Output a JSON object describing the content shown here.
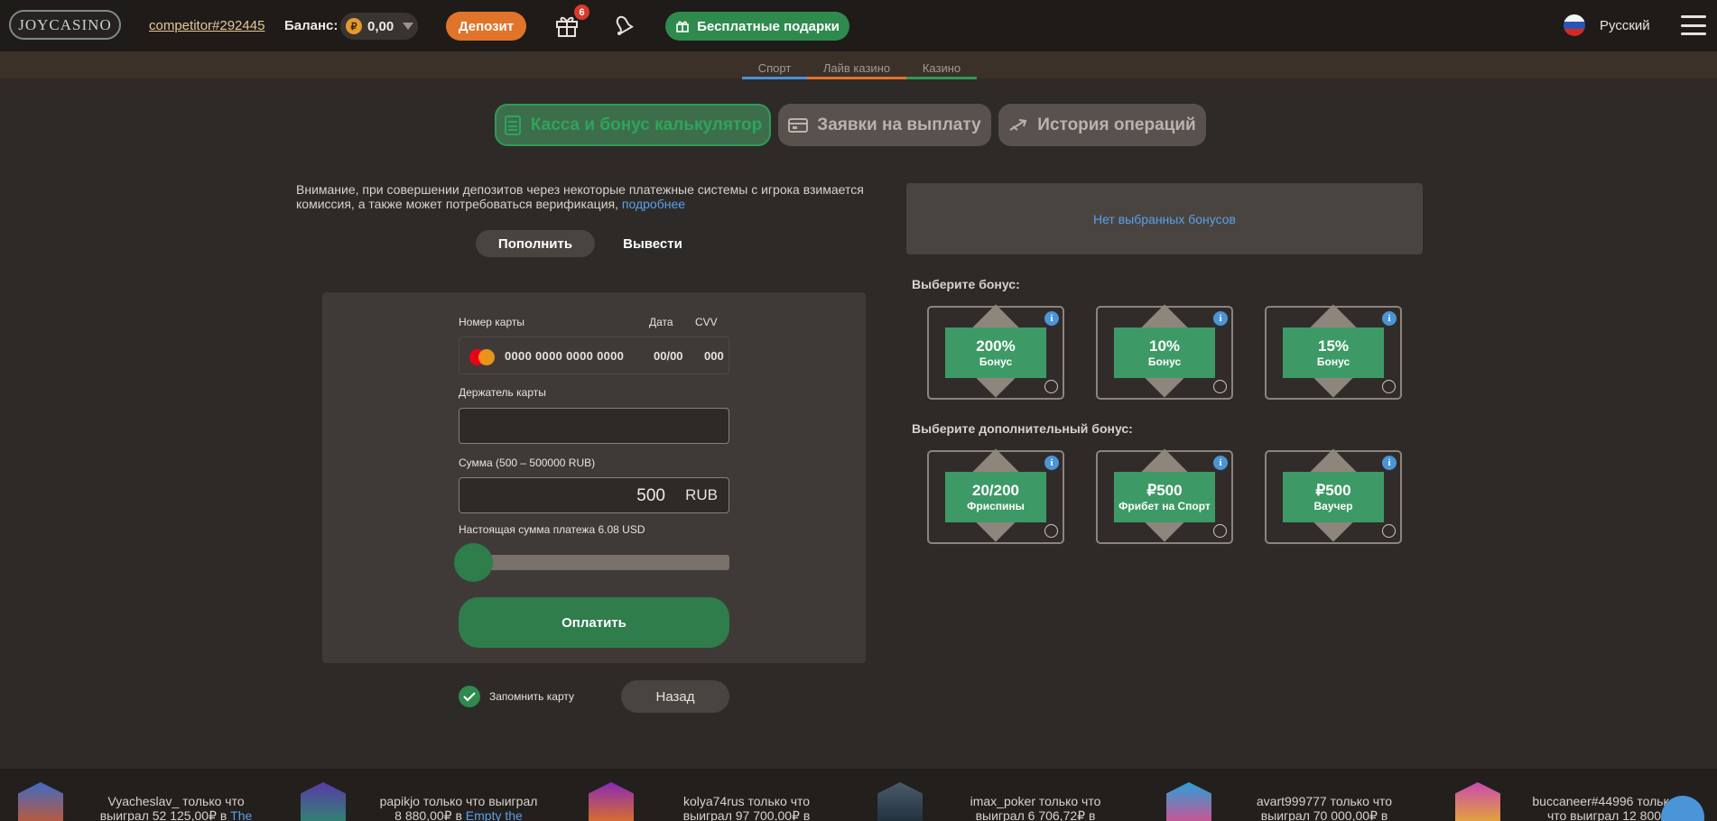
{
  "header": {
    "logo": "JOYCASINO",
    "username": "competitor#292445",
    "balance_label": "Баланс:",
    "coin_symbol": "₽",
    "balance_value": "0,00",
    "deposit_label": "Депозит",
    "gift_badge": "6",
    "free_gifts_label": "Бесплатные подарки",
    "language": "Русский"
  },
  "subnav": {
    "tabs": [
      {
        "label": "Спорт",
        "color": "#4a90d9"
      },
      {
        "label": "Лайв казино",
        "color": "#e0742a"
      },
      {
        "label": "Казино",
        "color": "#2f9a56"
      }
    ]
  },
  "main_tabs": {
    "cashier": "Касса и бонус калькулятор",
    "withdraw": "Заявки на выплату",
    "history": "История операций"
  },
  "notice": {
    "text": "Внимание, при совершении депозитов через некоторые платежные системы с игрока взимается комиссия, а также может потребоваться верификация,",
    "link": "подробнее"
  },
  "mode": {
    "deposit": "Пополнить",
    "withdraw": "Вывести"
  },
  "form": {
    "card_number_label": "Номер карты",
    "date_label": "Дата",
    "cvv_label": "CVV",
    "card_number_placeholder": "0000 0000 0000 0000",
    "date_placeholder": "00/00",
    "cvv_placeholder": "000",
    "holder_label": "Держатель карты",
    "holder_value": "",
    "amount_label": "Сумма (500 – 500000 RUB)",
    "amount_value": "500",
    "amount_currency": "RUB",
    "real_amount_label": "Настоящая сумма платежа 6.08 USD",
    "slider_fraction": 0,
    "pay_label": "Оплатить",
    "remember_label": "Запомнить карту",
    "remember_checked": true,
    "back_label": "Назад"
  },
  "bonuses": {
    "no_bonus_text": "Нет выбранных бонусов",
    "choose_title": "Выберите бонус:",
    "choose_extra_title": "Выберите дополнительный бонус:",
    "main": [
      {
        "big": "200%",
        "small": "Бонус"
      },
      {
        "big": "10%",
        "small": "Бонус"
      },
      {
        "big": "15%",
        "small": "Бонус"
      }
    ],
    "extra": [
      {
        "big": "20/200",
        "small": "Фриспины"
      },
      {
        "big": "₽500",
        "small": "Фрибет на Спорт"
      },
      {
        "big": "₽500",
        "small": "Ваучер"
      }
    ],
    "info_symbol": "i"
  },
  "ticker": [
    {
      "line1": "Vyacheslav_ только что",
      "line2": "выиграл 52 125,00₽ в",
      "game": "The"
    },
    {
      "line1": "papikjo только что выиграл",
      "line2": "8 880,00₽ в",
      "game": "Empty the"
    },
    {
      "line1": "kolya74rus только что",
      "line2": "выиграл 97 700,00₽ в",
      "game": ""
    },
    {
      "line1": "imax_poker только что",
      "line2": "выиграл 6 706,72₽ в",
      "game": ""
    },
    {
      "line1": "avart999777 только что",
      "line2": "выиграл 70 000,00₽ в",
      "game": ""
    },
    {
      "line1": "buccaneer#44996 только",
      "line2": "что выиграл 12 800",
      "game": ""
    }
  ]
}
